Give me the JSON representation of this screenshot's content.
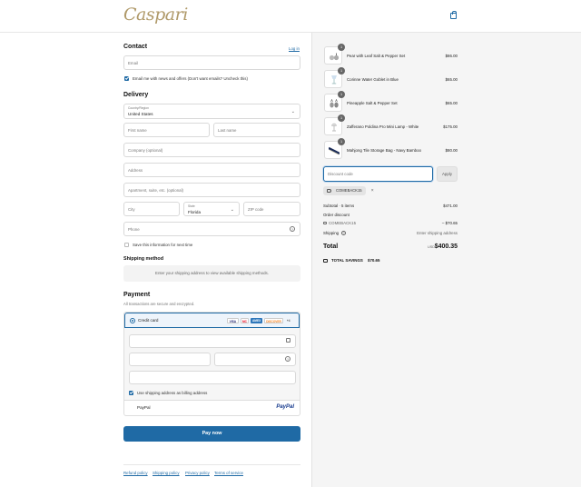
{
  "header": {
    "logo": "Caspari",
    "bag_icon": "shopping-bag-icon"
  },
  "contact": {
    "title": "Contact",
    "login_link": "Log in",
    "email_placeholder": "Email",
    "news_label": "Email me with news and offers (Don't want emails? Uncheck this)",
    "news_checked": true
  },
  "delivery": {
    "title": "Delivery",
    "country_label": "Country/Region",
    "country_value": "United States",
    "first_name": "First name",
    "last_name": "Last name",
    "company": "Company (optional)",
    "address": "Address",
    "apartment": "Apartment, suite, etc. (optional)",
    "city": "City",
    "state_label": "State",
    "state_value": "Florida",
    "zip": "ZIP code",
    "phone": "Phone",
    "save_info": "Save this information for next time"
  },
  "shipping": {
    "title": "Shipping method",
    "notice": "Enter your shipping address to view available shipping methods."
  },
  "payment": {
    "title": "Payment",
    "subtitle": "All transactions are secure and encrypted.",
    "credit_card": "Credit card",
    "card_brands": [
      "VISA",
      "MC",
      "AMEX",
      "DISCOVER",
      "+4"
    ],
    "billing_same": "Use shipping address as billing address",
    "paypal": "PayPal",
    "paypal_logo": "PayPal"
  },
  "pay_button": "Pay now",
  "footer": [
    "Refund policy",
    "Shipping policy",
    "Privacy policy",
    "Terms of service"
  ],
  "cart": {
    "items": [
      {
        "qty": "1",
        "name": "Pear with Leaf Salt & Pepper Set",
        "price": "$86.00"
      },
      {
        "qty": "1",
        "name": "Corinne Water Goblet in Blue",
        "price": "$65.00"
      },
      {
        "qty": "1",
        "name": "Pineapple Salt & Pepper Set",
        "price": "$65.00"
      },
      {
        "qty": "1",
        "name": "Zafferano Poldina Pro Mini Lamp - White",
        "price": "$175.00"
      },
      {
        "qty": "1",
        "name": "Mahjong Tile Storage Bag - Navy Bamboo",
        "price": "$80.00"
      }
    ],
    "discount_placeholder": "Discount code",
    "apply": "Apply",
    "applied_code": "COMEBACK15",
    "subtotal_label": "Subtotal · 5 items",
    "subtotal_value": "$471.00",
    "order_discount": "Order discount",
    "discount_code": "COMEBACK15",
    "discount_value": "– $70.65",
    "shipping_label": "Shipping",
    "shipping_value": "Enter shipping address",
    "total_label": "Total",
    "currency": "USD",
    "total_value": "$400.35",
    "savings_label": "TOTAL SAVINGS",
    "savings_value": "$70.65"
  }
}
